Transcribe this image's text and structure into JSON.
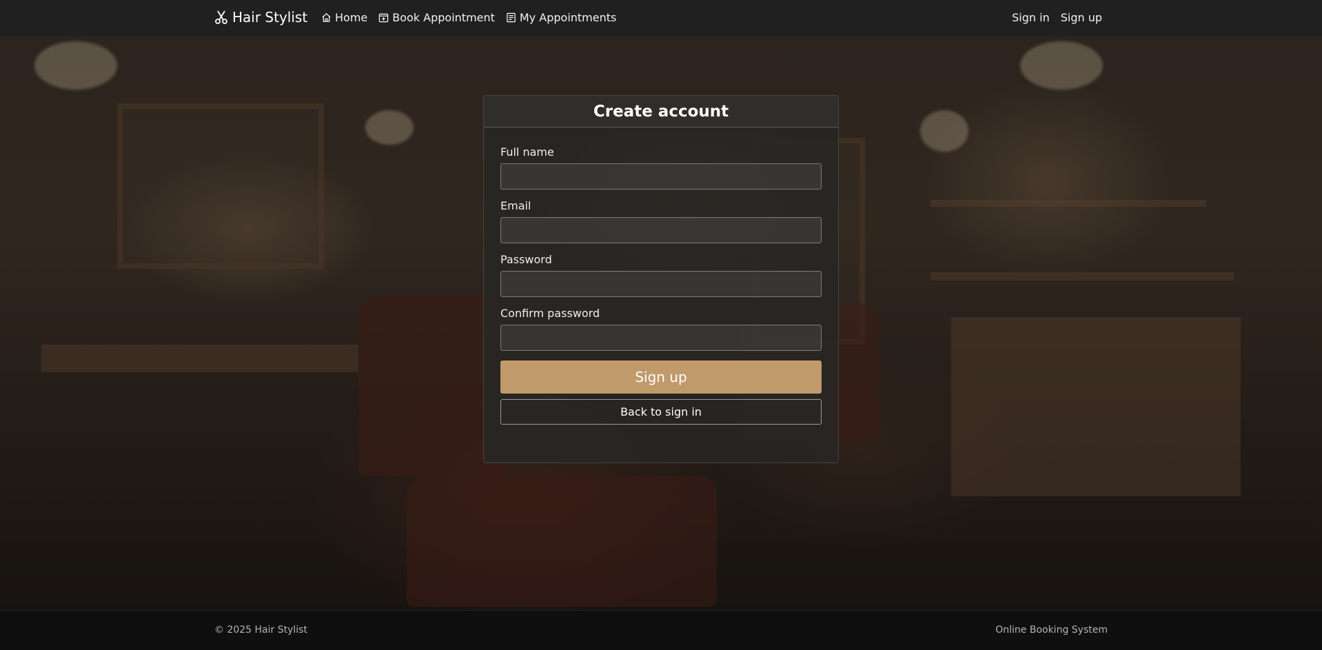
{
  "navbar": {
    "brand": "Hair Stylist",
    "brand_icon": "scissors-icon",
    "links": [
      {
        "label": "Home",
        "icon": "home-icon"
      },
      {
        "label": "Book Appointment",
        "icon": "calendar-plus-icon"
      },
      {
        "label": "My Appointments",
        "icon": "list-icon"
      }
    ],
    "auth": {
      "sign_in": "Sign in",
      "sign_up": "Sign up"
    }
  },
  "form": {
    "title": "Create account",
    "fields": [
      {
        "label": "Full name",
        "value": ""
      },
      {
        "label": "Email",
        "value": ""
      },
      {
        "label": "Password",
        "value": ""
      },
      {
        "label": "Confirm password",
        "value": ""
      }
    ],
    "submit_label": "Sign up",
    "back_label": "Back to sign in"
  },
  "footer": {
    "copyright": "© 2025 Hair Stylist",
    "tagline": "Online Booking System"
  },
  "colors": {
    "accent": "#c19a6b",
    "navbar_bg": "#212121",
    "footer_bg": "#101010"
  }
}
